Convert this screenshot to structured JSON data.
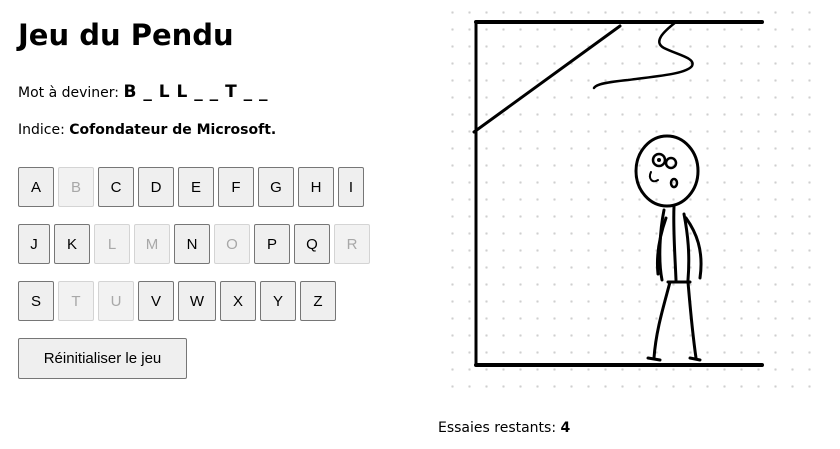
{
  "title": "Jeu du Pendu",
  "word_label": "Mot à deviner:",
  "word": "B _ L L _ _ T _ _",
  "hint_label": "Indice:",
  "hint": "Cofondateur de Microsoft.",
  "keyboard": {
    "row1": [
      {
        "letter": "A",
        "used": false
      },
      {
        "letter": "B",
        "used": true
      },
      {
        "letter": "C",
        "used": false
      },
      {
        "letter": "D",
        "used": false
      },
      {
        "letter": "E",
        "used": false
      },
      {
        "letter": "F",
        "used": false
      },
      {
        "letter": "G",
        "used": false
      },
      {
        "letter": "H",
        "used": false
      },
      {
        "letter": "I",
        "used": false
      }
    ],
    "row2": [
      {
        "letter": "J",
        "used": false
      },
      {
        "letter": "K",
        "used": false
      },
      {
        "letter": "L",
        "used": true
      },
      {
        "letter": "M",
        "used": true
      },
      {
        "letter": "N",
        "used": false
      },
      {
        "letter": "O",
        "used": true
      },
      {
        "letter": "P",
        "used": false
      },
      {
        "letter": "Q",
        "used": false
      },
      {
        "letter": "R",
        "used": true
      }
    ],
    "row3": [
      {
        "letter": "S",
        "used": false
      },
      {
        "letter": "T",
        "used": true
      },
      {
        "letter": "U",
        "used": true
      },
      {
        "letter": "V",
        "used": false
      },
      {
        "letter": "W",
        "used": false
      },
      {
        "letter": "X",
        "used": false
      },
      {
        "letter": "Y",
        "used": false
      },
      {
        "letter": "Z",
        "used": false
      }
    ]
  },
  "reset_label": "Réinitialiser le jeu",
  "tries_label": "Essaies restants:",
  "tries_value": "4"
}
